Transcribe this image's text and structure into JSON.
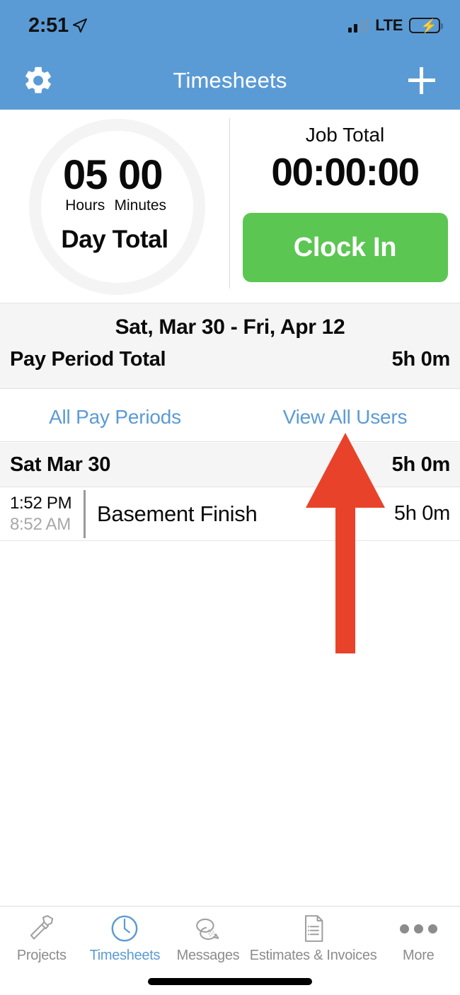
{
  "status_bar": {
    "time": "2:51",
    "location_icon": "location-arrow-icon",
    "carrier_network": "LTE",
    "battery_charging": true,
    "signal_bars": 4
  },
  "nav_bar": {
    "title": "Timesheets",
    "settings_icon": "gear-icon",
    "add_icon": "plus-icon",
    "background_color": "#5B9BD5"
  },
  "timer": {
    "hours_value": "05",
    "hours_label": "Hours",
    "minutes_value": "00",
    "minutes_label": "Minutes",
    "day_total_label": "Day Total",
    "job_total_label": "Job Total",
    "job_total_value": "00:00:00",
    "clock_in_label": "Clock In",
    "clock_in_color": "#5CC653"
  },
  "pay_period": {
    "range": "Sat, Mar 30 - Fri, Apr 12",
    "total_label": "Pay Period Total",
    "total_value": "5h 0m"
  },
  "links": {
    "all_pay_periods": "All Pay Periods",
    "view_all_users": "View All Users",
    "link_color": "#5B9BD5"
  },
  "day_group": {
    "date_label": "Sat Mar 30",
    "date_total": "5h 0m"
  },
  "entries": [
    {
      "time_out": "1:52 PM",
      "time_in": "8:52 AM",
      "job_name": "Basement Finish",
      "duration": "5h 0m"
    }
  ],
  "annotation": {
    "type": "arrow-up",
    "color": "#E8432A",
    "points_to": "View All Users"
  },
  "tab_bar": {
    "active_tab": "Timesheets",
    "tabs": [
      {
        "label": "Projects",
        "icon": "hammer-icon",
        "active": false
      },
      {
        "label": "Timesheets",
        "icon": "clock-icon",
        "active": true
      },
      {
        "label": "Messages",
        "icon": "chat-bubbles-icon",
        "active": false
      },
      {
        "label": "Estimates & Invoices",
        "icon": "document-list-icon",
        "active": false
      },
      {
        "label": "More",
        "icon": "ellipsis-icon",
        "active": false
      }
    ]
  }
}
